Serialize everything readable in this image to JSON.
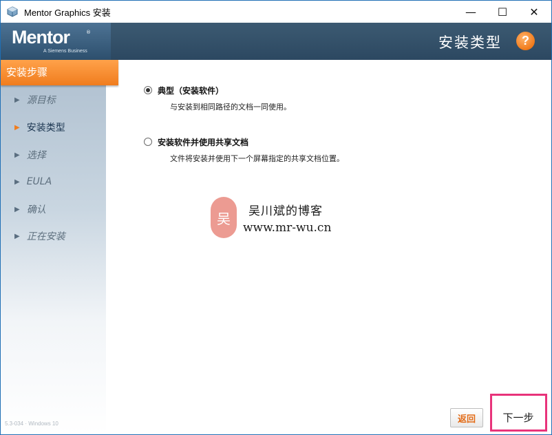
{
  "window": {
    "title": "Mentor Graphics 安装",
    "controls": {
      "minimize": "—",
      "maximize": "☐",
      "close": "✕"
    }
  },
  "header": {
    "logo": "Mentor",
    "logo_tm": "®",
    "logo_subtitle": "A Siemens Business",
    "page_title": "安装类型",
    "help_label": "?"
  },
  "sidebar": {
    "heading": "安装步骤",
    "steps": [
      {
        "label": "源目标",
        "active": false
      },
      {
        "label": "安装类型",
        "active": true
      },
      {
        "label": "选择",
        "active": false
      },
      {
        "label": "EULA",
        "active": false
      },
      {
        "label": "确认",
        "active": false
      },
      {
        "label": "正在安装",
        "active": false
      }
    ],
    "version": "5.3-034 · Windows 10"
  },
  "options": [
    {
      "label": "典型（安装软件）",
      "description": "与安装到相同路径的文档一同使用。",
      "selected": true
    },
    {
      "label": "安装软件并使用共享文档",
      "description": "文件将安装并使用下一个屏幕指定的共享文档位置。",
      "selected": false
    }
  ],
  "watermark": {
    "badge": "吴",
    "line1": "吴川斌的博客",
    "line2": "www.mr-wu.cn"
  },
  "buttons": {
    "back": "返回",
    "next": "下一步"
  },
  "colors": {
    "accent_orange": "#f07d1e",
    "banner": "#2c4861",
    "highlight_border": "#e8337a"
  }
}
